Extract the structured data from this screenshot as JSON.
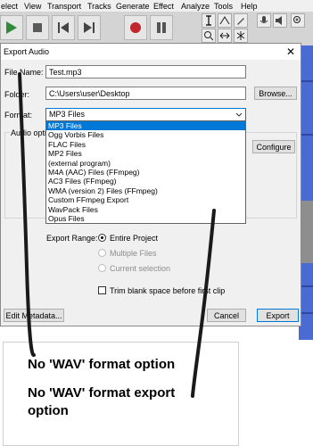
{
  "menubar": {
    "items": [
      "elect",
      "View",
      "Transport",
      "Tracks",
      "Generate",
      "Effect",
      "Analyze",
      "Tools",
      "Help"
    ]
  },
  "dialog": {
    "title": "Export Audio",
    "close_glyph": "✕",
    "file_name_label": "File Name:",
    "file_name_value": "Test.mp3",
    "folder_label": "Folder:",
    "folder_value": "C:\\Users\\user\\Desktop",
    "browse_label": "Browse...",
    "format_label": "Format:",
    "format_value": "MP3 Files",
    "audio_options_label": "Audio opti",
    "configure_label": "Configure",
    "format_options": [
      "MP3 Files",
      "Ogg Vorbis Files",
      "FLAC Files",
      "MP2 Files",
      "(external program)",
      "M4A (AAC) Files (FFmpeg)",
      "AC3 Files (FFmpeg)",
      "WMA (version 2) Files (FFmpeg)",
      "Custom FFmpeg Export",
      "WavPack Files",
      "Opus Files"
    ],
    "export_range_label": "Export Range:",
    "range_entire": "Entire Project",
    "range_multiple": "Multiple Files",
    "range_selection": "Current selection",
    "trim_label": "Trim blank space before first clip",
    "edit_metadata_label": "Edit Metadata...",
    "cancel_label": "Cancel",
    "export_label": "Export"
  },
  "annotation": {
    "line1": "No 'WAV' format option",
    "line2a": "No 'WAV' format export",
    "line2b": "option"
  }
}
